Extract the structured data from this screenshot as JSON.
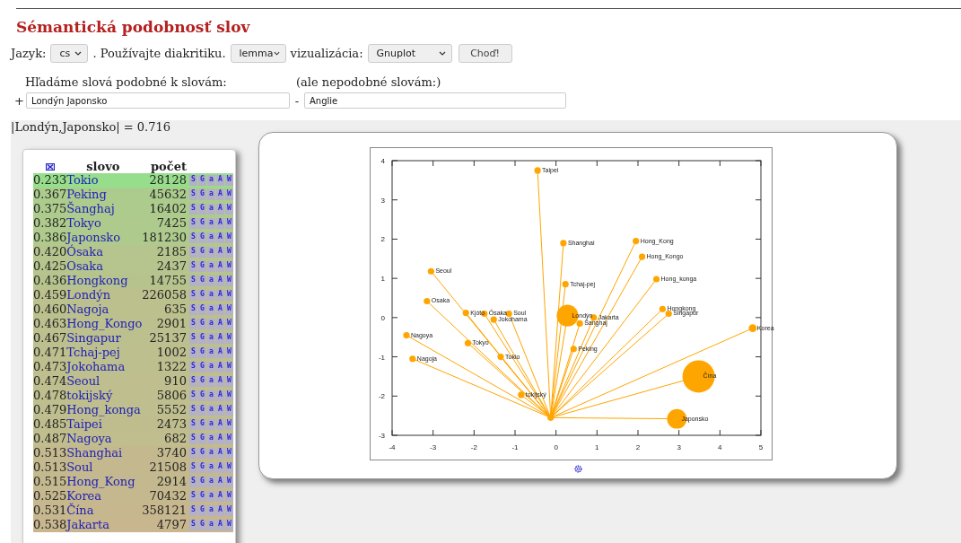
{
  "title": "Sémantická podobnosť slov",
  "form": {
    "language_label": "Jazyk:",
    "language": "cs",
    "diacritics_label": ". Používajte diakritiku.",
    "mode": "lemma",
    "viz_label": "vizualizácia:",
    "viz": "Gnuplot",
    "submit": "Choď!"
  },
  "query": {
    "positive_label": "Hľadáme slová podobné k slovám:",
    "negative_label": "(ale nepodobné slovám:)",
    "plus": "+",
    "minus": "-",
    "positive": "Londýn Japonsko",
    "negative": "Anglie"
  },
  "similarity": "|Londýn,Japonsko| = 0.716",
  "table": {
    "columns": [
      "slovo",
      "počet"
    ],
    "rows": [
      {
        "score": "0.233",
        "word": "Tokio",
        "count": "28128",
        "links": [
          "S",
          "G",
          "a",
          "A",
          "W"
        ]
      },
      {
        "score": "0.367",
        "word": "Peking",
        "count": "45632",
        "links": [
          "S",
          "G",
          "a",
          "A",
          "W"
        ]
      },
      {
        "score": "0.375",
        "word": "Šanghaj",
        "count": "16402",
        "links": [
          "S",
          "G",
          "a",
          "A",
          "W"
        ]
      },
      {
        "score": "0.382",
        "word": "Tokyo",
        "count": "7425",
        "links": [
          "S",
          "G",
          "a",
          "A",
          "W"
        ]
      },
      {
        "score": "0.386",
        "word": "Japonsko",
        "count": "181230",
        "links": [
          "S",
          "G",
          "a",
          "A",
          "W"
        ]
      },
      {
        "score": "0.420",
        "word": "Ósaka",
        "count": "2185",
        "links": [
          "S",
          "G",
          "a",
          "A",
          "W"
        ]
      },
      {
        "score": "0.425",
        "word": "Osaka",
        "count": "2437",
        "links": [
          "S",
          "G",
          "a",
          "A",
          "W"
        ]
      },
      {
        "score": "0.436",
        "word": "Hongkong",
        "count": "14755",
        "links": [
          "S",
          "G",
          "a",
          "A",
          "W"
        ]
      },
      {
        "score": "0.459",
        "word": "Londýn",
        "count": "226058",
        "links": [
          "S",
          "G",
          "a",
          "A",
          "W"
        ]
      },
      {
        "score": "0.460",
        "word": "Nagoja",
        "count": "635",
        "links": [
          "S",
          "G",
          "a",
          "A",
          "W"
        ]
      },
      {
        "score": "0.463",
        "word": "Hong_Kongo",
        "count": "2901",
        "links": [
          "S",
          "G",
          "a",
          "A",
          "W"
        ]
      },
      {
        "score": "0.467",
        "word": "Singapur",
        "count": "25137",
        "links": [
          "S",
          "G",
          "a",
          "A",
          "W"
        ]
      },
      {
        "score": "0.471",
        "word": "Tchaj-pej",
        "count": "1002",
        "links": [
          "S",
          "G",
          "a",
          "A",
          "W"
        ]
      },
      {
        "score": "0.473",
        "word": "Jokohama",
        "count": "1322",
        "links": [
          "S",
          "G",
          "a",
          "A",
          "W"
        ]
      },
      {
        "score": "0.474",
        "word": "Seoul",
        "count": "910",
        "links": [
          "S",
          "G",
          "a",
          "A",
          "W"
        ]
      },
      {
        "score": "0.478",
        "word": "tokijský",
        "count": "5806",
        "links": [
          "S",
          "G",
          "a",
          "A",
          "W"
        ]
      },
      {
        "score": "0.479",
        "word": "Hong_konga",
        "count": "5552",
        "links": [
          "S",
          "G",
          "a",
          "A",
          "W"
        ]
      },
      {
        "score": "0.485",
        "word": "Taipei",
        "count": "2473",
        "links": [
          "S",
          "G",
          "a",
          "A",
          "W"
        ]
      },
      {
        "score": "0.487",
        "word": "Nagoya",
        "count": "682",
        "links": [
          "S",
          "G",
          "a",
          "A",
          "W"
        ]
      },
      {
        "score": "0.513",
        "word": "Shanghai",
        "count": "3740",
        "links": [
          "S",
          "G",
          "a",
          "A",
          "W"
        ]
      },
      {
        "score": "0.513",
        "word": "Soul",
        "count": "21508",
        "links": [
          "S",
          "G",
          "a",
          "A",
          "W"
        ]
      },
      {
        "score": "0.515",
        "word": "Hong_Kong",
        "count": "2914",
        "links": [
          "S",
          "G",
          "a",
          "A",
          "W"
        ]
      },
      {
        "score": "0.525",
        "word": "Korea",
        "count": "70432",
        "links": [
          "S",
          "G",
          "a",
          "A",
          "W"
        ]
      },
      {
        "score": "0.531",
        "word": "Čína",
        "count": "358121",
        "links": [
          "S",
          "G",
          "a",
          "A",
          "W"
        ]
      },
      {
        "score": "0.538",
        "word": "Jakarta",
        "count": "4797",
        "links": [
          "S",
          "G",
          "a",
          "A",
          "W"
        ]
      }
    ]
  },
  "chart_data": {
    "type": "scatter",
    "xlim": [
      -4,
      5
    ],
    "ylim": [
      -3,
      4
    ],
    "xticks": [
      -4,
      -3,
      -2,
      -1,
      0,
      1,
      2,
      3,
      4,
      5
    ],
    "yticks": [
      -3,
      -2,
      -1,
      0,
      1,
      2,
      3,
      4
    ],
    "x": [
      -0.13,
      -0.45,
      0.18,
      1.95,
      2.1,
      2.45,
      -3.05,
      0.23,
      -3.15,
      -2.2,
      -1.75,
      -1.15,
      -1.52,
      0.28,
      0.58,
      0.92,
      2.6,
      2.75,
      4.8,
      -3.65,
      -2.15,
      -1.35,
      0.43,
      -3.5,
      -0.85,
      3.48,
      2.95
    ],
    "series": [
      {
        "color": "#ffa500",
        "values": [
          -2.55,
          3.75,
          1.9,
          1.95,
          1.55,
          0.98,
          1.18,
          0.85,
          0.42,
          0.12,
          0.1,
          0.1,
          -0.05,
          0.05,
          -0.15,
          0.0,
          0.22,
          0.1,
          -0.27,
          -0.45,
          -0.65,
          -1.0,
          -0.8,
          -1.05,
          -1.97,
          -1.5,
          -2.58
        ],
        "sizes": [
          0.04,
          0.04,
          0.04,
          0.04,
          0.04,
          0.04,
          0.04,
          0.04,
          0.04,
          0.04,
          0.04,
          0.04,
          0.04,
          0.45,
          0.04,
          0.04,
          0.04,
          0.04,
          0.06,
          0.04,
          0.04,
          0.04,
          0.04,
          0.04,
          0.04,
          1,
          0.37
        ]
      }
    ],
    "annotations": [
      {
        "x": -0.45,
        "y": 3.75,
        "text": "Taipei"
      },
      {
        "x": 0.18,
        "y": 1.9,
        "text": "Shanghai"
      },
      {
        "x": 1.95,
        "y": 1.95,
        "text": "Hong_Kong"
      },
      {
        "x": 2.1,
        "y": 1.55,
        "text": "Hong_Kongo"
      },
      {
        "x": 2.45,
        "y": 0.98,
        "text": "Hong_konga"
      },
      {
        "x": -3.05,
        "y": 1.18,
        "text": "Seoul"
      },
      {
        "x": 0.23,
        "y": 0.85,
        "text": "Tchaj-pej"
      },
      {
        "x": -3.15,
        "y": 0.42,
        "text": "Osaka"
      },
      {
        "x": -2.2,
        "y": 0.12,
        "text": "Kjóto"
      },
      {
        "x": -1.75,
        "y": 0.1,
        "text": "Ósaka"
      },
      {
        "x": -1.15,
        "y": 0.1,
        "text": "Soul"
      },
      {
        "x": -1.52,
        "y": -0.05,
        "text": "Jokohama"
      },
      {
        "x": 0.28,
        "y": 0.05,
        "text": "Londýn"
      },
      {
        "x": 0.58,
        "y": -0.15,
        "text": "Šanghaj"
      },
      {
        "x": 0.92,
        "y": 0.0,
        "text": "Jakarta"
      },
      {
        "x": 2.6,
        "y": 0.22,
        "text": "Hongkong"
      },
      {
        "x": 2.75,
        "y": 0.1,
        "text": "Singapur"
      },
      {
        "x": 4.8,
        "y": -0.27,
        "text": "Korea"
      },
      {
        "x": -3.65,
        "y": -0.45,
        "text": "Nagoya"
      },
      {
        "x": -2.15,
        "y": -0.65,
        "text": "Tokyo"
      },
      {
        "x": -1.35,
        "y": -1.0,
        "text": "Tokio"
      },
      {
        "x": 0.43,
        "y": -0.8,
        "text": "Peking"
      },
      {
        "x": -3.5,
        "y": -1.05,
        "text": "Nagoja"
      },
      {
        "x": -0.85,
        "y": -1.97,
        "text": "tokijský"
      },
      {
        "x": 3.48,
        "y": -1.5,
        "text": "Čína"
      },
      {
        "x": 2.95,
        "y": -2.58,
        "text": "Japonsko"
      }
    ]
  }
}
